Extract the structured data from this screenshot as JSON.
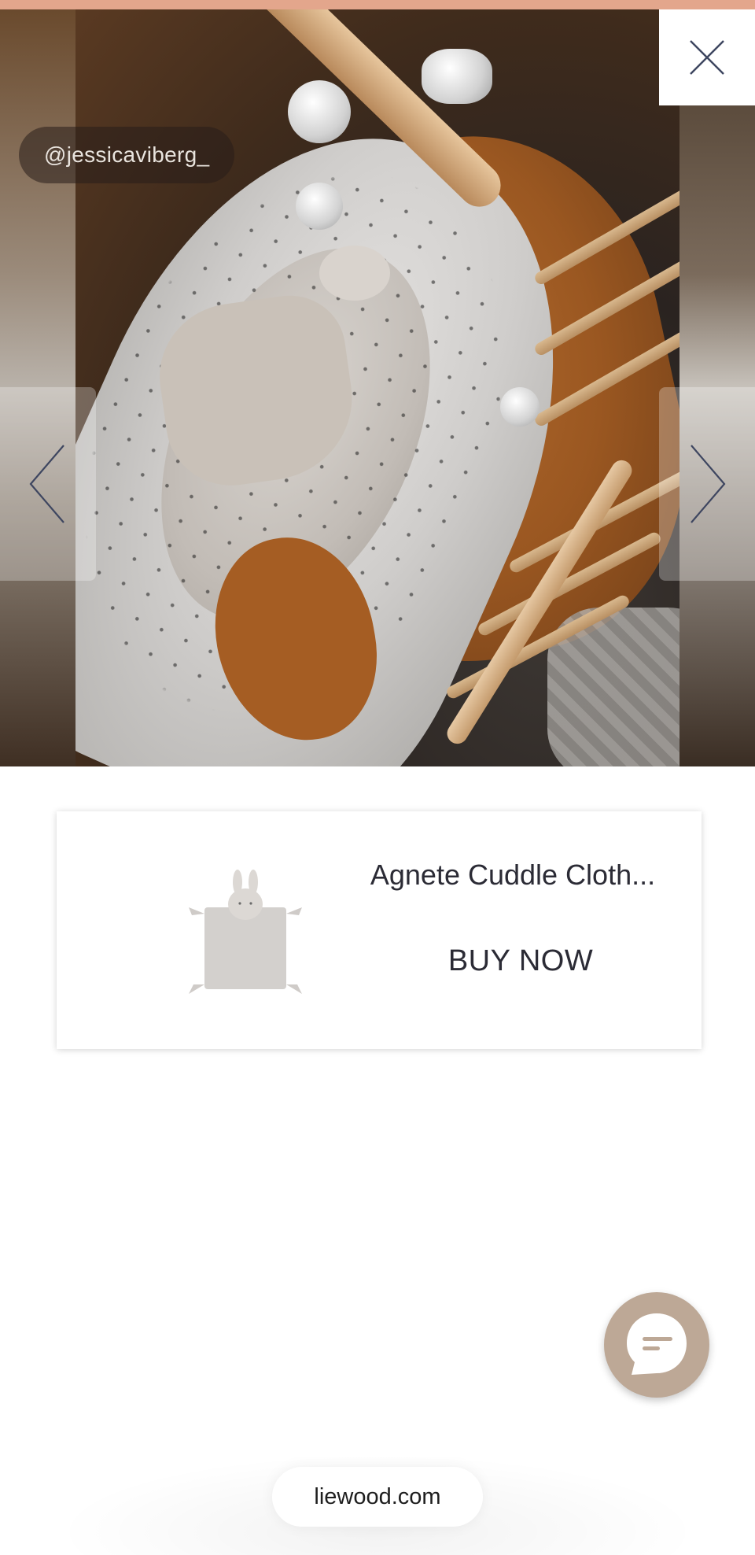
{
  "gallery": {
    "user_handle": "@jessicaviberg_",
    "close_icon": "close-icon",
    "prev_icon": "chevron-left-icon",
    "next_icon": "chevron-right-icon"
  },
  "product": {
    "name": "Agnete Cuddle Cloth...",
    "buy_label": "BUY NOW"
  },
  "chat": {
    "icon": "chat-icon",
    "color": "#bda896"
  },
  "footer": {
    "site": "liewood.com"
  },
  "colors": {
    "top_strip": "#e3a68c",
    "text": "#2b2b35"
  }
}
